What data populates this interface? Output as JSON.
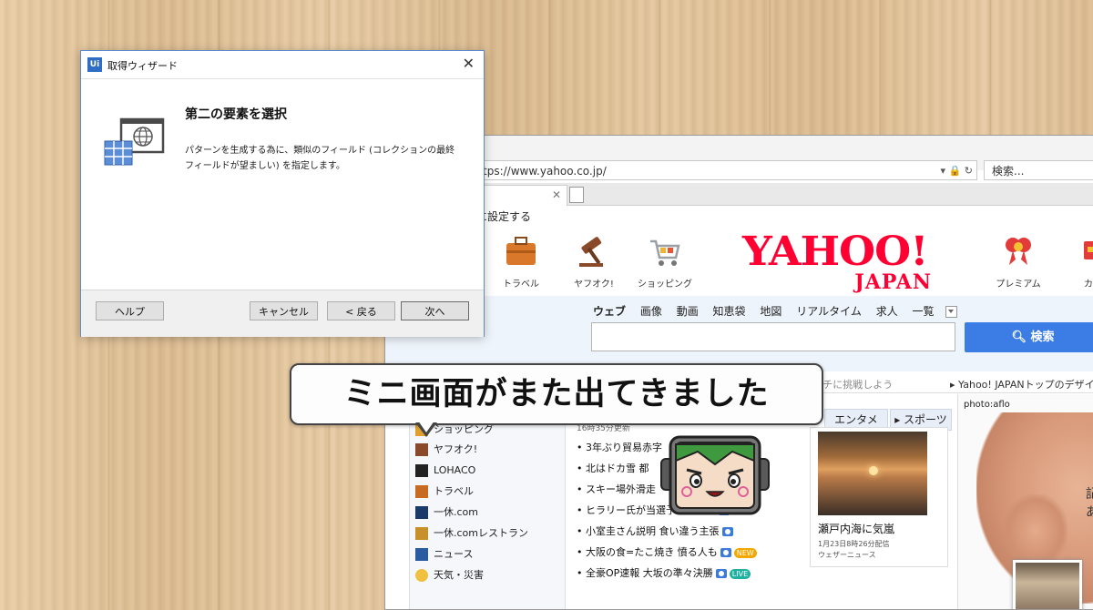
{
  "browser": {
    "url": "tps://www.yahoo.co.jp/",
    "search_placeholder": "検索...",
    "favorites_text": "に設定する",
    "services": [
      {
        "label": "トラベル",
        "icon": "suitcase-icon"
      },
      {
        "label": "ヤフオク!",
        "icon": "auction-gavel-icon"
      },
      {
        "label": "ショッピング",
        "icon": "shopping-cart-icon"
      },
      {
        "label": "プレミアム",
        "icon": "ribbon-icon"
      },
      {
        "label": "カー",
        "icon": "card-icon"
      }
    ],
    "logo": {
      "main": "YAHOO!",
      "sub": "JAPAN"
    },
    "search_tabs": [
      "ウェブ",
      "画像",
      "動画",
      "知恵袋",
      "地図",
      "リアルタイム",
      "求人",
      "一覧"
    ],
    "search_button": "検索",
    "ticker_left": "アクティ_キ_スキマ_作目の入選… … 1日1回 ヤフオクスクラッチに挑戦しよう",
    "ticker_right": "Yahoo! JAPANトップのデザイン",
    "left_nav": [
      {
        "label": "ショッピング",
        "color": "#e0a030"
      },
      {
        "label": "ヤフオク!",
        "color": "#8a4a2a"
      },
      {
        "label": "LOHACO",
        "color": "#222222"
      },
      {
        "label": "トラベル",
        "color": "#c86a20"
      },
      {
        "label": "一休.com",
        "color": "#1a3a6a"
      },
      {
        "label": "一休.comレストラン",
        "color": "#c8902a"
      },
      {
        "label": "ニュース",
        "color": "#2a5aa0"
      },
      {
        "label": "天気・災害",
        "color": "#f0c040"
      }
    ],
    "topic_tabs": [
      "エンタメ",
      "スポーツ"
    ],
    "timestamp": "16時35分更新",
    "news": [
      {
        "text": "3年ぶり貿易赤字",
        "badge": ""
      },
      {
        "text": "北はドカ雪 都",
        "badge": ""
      },
      {
        "text": "スキー場外滑走",
        "badge": ""
      },
      {
        "text": "ヒラリー氏が当選予想の見出",
        "badge": "cam"
      },
      {
        "text": "小室圭さん説明 食い違う主張",
        "badge": "cam"
      },
      {
        "text": "大阪の食=たこ焼き 憤る人も",
        "badge": "NEW"
      },
      {
        "text": "全豪OP速報 大坂の準々決勝",
        "badge": "LIVE"
      }
    ],
    "weather": {
      "title": "瀬戸内海に気嵐",
      "date": "1月23日8時26分配信",
      "source": "ウェザーニュース"
    },
    "photo_credit": "photo:aflo",
    "photo_text": "記\nあ"
  },
  "dialog": {
    "title": "取得ウィザード",
    "logo": "Ui",
    "heading": "第二の要素を選択",
    "description": "パターンを生成する為に、類似のフィールド (コレクションの最終フィールドが望ましい) を指定します。",
    "buttons": {
      "help": "ヘルプ",
      "cancel": "キャンセル",
      "back": "< 戻る",
      "next": "次へ"
    }
  },
  "callout": {
    "text": "ミニ画面がまた出てきました"
  },
  "colors": {
    "yahoo_red": "#ff0033",
    "search_blue": "#3b7ce5",
    "dialog_border": "#5d8ac8"
  }
}
